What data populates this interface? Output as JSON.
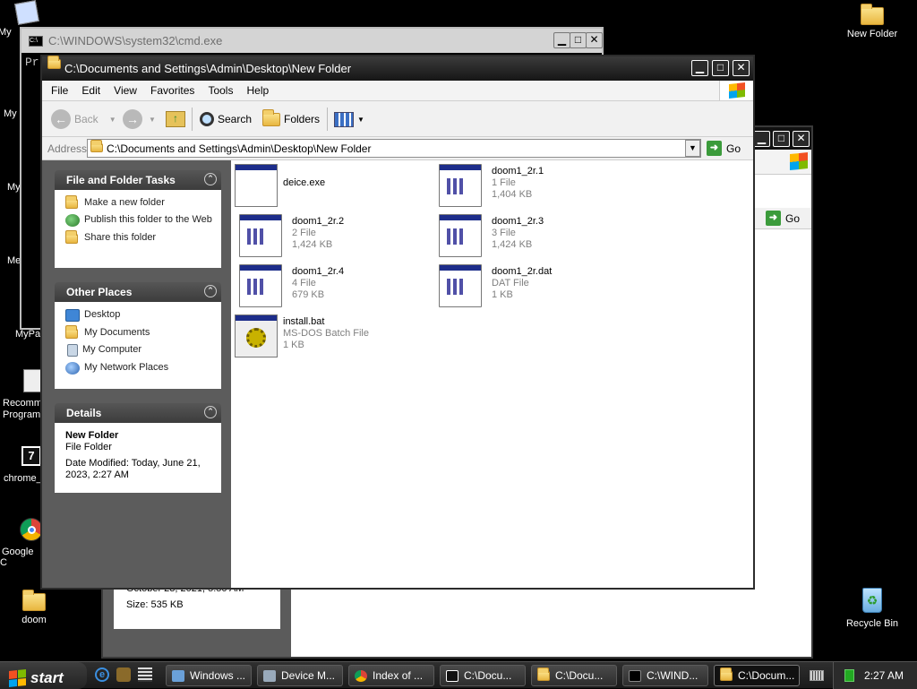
{
  "desktop": {
    "left_labels": [
      "My",
      "My",
      "My",
      "Me",
      "MyPa",
      "Recomm Program",
      "chrome_",
      "Google C",
      "doom"
    ],
    "new_folder": "New Folder",
    "recycle_bin": "Recycle Bin"
  },
  "cmd": {
    "title": "C:\\WINDOWS\\system32\\cmd.exe",
    "line": "Pr"
  },
  "bgwin": {
    "go_label": "Go",
    "details_date": "October 23, 2021, 5:50 AM",
    "details_size": "Size: 535 KB"
  },
  "explorer": {
    "title": "C:\\Documents and Settings\\Admin\\Desktop\\New Folder",
    "menu": [
      "File",
      "Edit",
      "View",
      "Favorites",
      "Tools",
      "Help"
    ],
    "toolbar": {
      "back": "Back",
      "search": "Search",
      "folders": "Folders"
    },
    "address_label": "Address",
    "address_value": "C:\\Documents and Settings\\Admin\\Desktop\\New Folder",
    "go_label": "Go",
    "tasks_panel": {
      "title": "File and Folder Tasks",
      "items": [
        "Make a new folder",
        "Publish this folder to the Web",
        "Share this folder"
      ]
    },
    "places_panel": {
      "title": "Other Places",
      "items": [
        "Desktop",
        "My Documents",
        "My Computer",
        "My Network Places"
      ]
    },
    "details_panel": {
      "title": "Details",
      "name": "New Folder",
      "type": "File Folder",
      "modified": "Date Modified: Today, June 21, 2023, 2:27 AM"
    },
    "files": [
      {
        "name": "deice.exe",
        "line2": "",
        "line3": "",
        "icon": "exe-window-icon"
      },
      {
        "name": "doom1_2r.1",
        "line2": "1 File",
        "line3": "1,404 KB",
        "icon": "generic-file-icon"
      },
      {
        "name": "doom1_2r.2",
        "line2": "2 File",
        "line3": "1,424 KB",
        "icon": "generic-file-icon"
      },
      {
        "name": "doom1_2r.3",
        "line2": "3 File",
        "line3": "1,424 KB",
        "icon": "generic-file-icon"
      },
      {
        "name": "doom1_2r.4",
        "line2": "4 File",
        "line3": "679 KB",
        "icon": "generic-file-icon"
      },
      {
        "name": "doom1_2r.dat",
        "line2": "DAT File",
        "line3": "1 KB",
        "icon": "generic-file-icon"
      },
      {
        "name": "install.bat",
        "line2": "MS-DOS Batch File",
        "line3": "1 KB",
        "icon": "batch-file-gear-icon"
      }
    ]
  },
  "taskbar": {
    "start": "start",
    "buttons": [
      "Windows ...",
      "Device M...",
      "Index of ...",
      "C:\\Docu...",
      "C:\\Docu...",
      "C:\\WIND...",
      "C:\\Docum..."
    ],
    "clock": "2:27 AM"
  }
}
